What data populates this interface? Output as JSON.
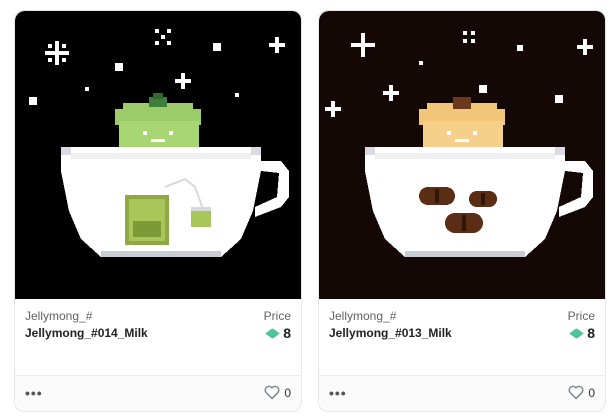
{
  "cards": [
    {
      "collection": "Jellymong_#",
      "name": "Jellymong_#014_Milk",
      "price_label": "Price",
      "price": "8",
      "likes": "0",
      "more": "•••",
      "art": "matcha-tea-cup"
    },
    {
      "collection": "Jellymong_#",
      "name": "Jellymong_#013_Milk",
      "price_label": "Price",
      "price": "8",
      "likes": "0",
      "more": "•••",
      "art": "coffee-bean-cup"
    }
  ],
  "colors": {
    "card_bg_1": "#000000",
    "card_bg_2": "#140806",
    "price_gem": "#4fc39a",
    "border": "#e4e6ea"
  },
  "icons": [
    "heart-icon",
    "more-icon",
    "price-gem-icon"
  ]
}
